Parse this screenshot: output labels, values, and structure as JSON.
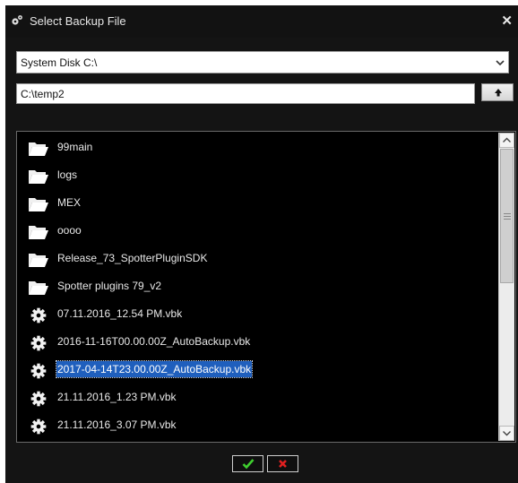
{
  "dialog": {
    "title": "Select Backup File",
    "close_symbol": "✕"
  },
  "drive": {
    "selected": "System Disk C:\\"
  },
  "path": {
    "value": "C:\\temp2"
  },
  "files": [
    {
      "name": "99main",
      "type": "folder",
      "icon": "folder-icon"
    },
    {
      "name": "logs",
      "type": "folder",
      "icon": "folder-icon"
    },
    {
      "name": "MEX",
      "type": "folder",
      "icon": "folder-icon"
    },
    {
      "name": "oooo",
      "type": "folder",
      "icon": "folder-icon"
    },
    {
      "name": "Release_73_SpotterPluginSDK",
      "type": "folder",
      "icon": "folder-icon"
    },
    {
      "name": "Spotter plugins 79_v2",
      "type": "folder",
      "icon": "folder-icon"
    },
    {
      "name": "07.11.2016_12.54 PM.vbk",
      "type": "file",
      "icon": "gear-icon"
    },
    {
      "name": "2016-11-16T00.00.00Z_AutoBackup.vbk",
      "type": "file",
      "icon": "gear-icon"
    },
    {
      "name": "2017-04-14T23.00.00Z_AutoBackup.vbk",
      "type": "file",
      "icon": "gear-icon",
      "selected": true
    },
    {
      "name": "21.11.2016_1.23 PM.vbk",
      "type": "file",
      "icon": "gear-icon"
    },
    {
      "name": "21.11.2016_3.07 PM.vbk",
      "type": "file",
      "icon": "gear-icon"
    }
  ],
  "colors": {
    "dialog_bg": "#141414",
    "list_bg": "#000000",
    "selection": "#1f5fbd",
    "ok_green": "#3fcf2f",
    "cancel_red": "#e02020"
  }
}
